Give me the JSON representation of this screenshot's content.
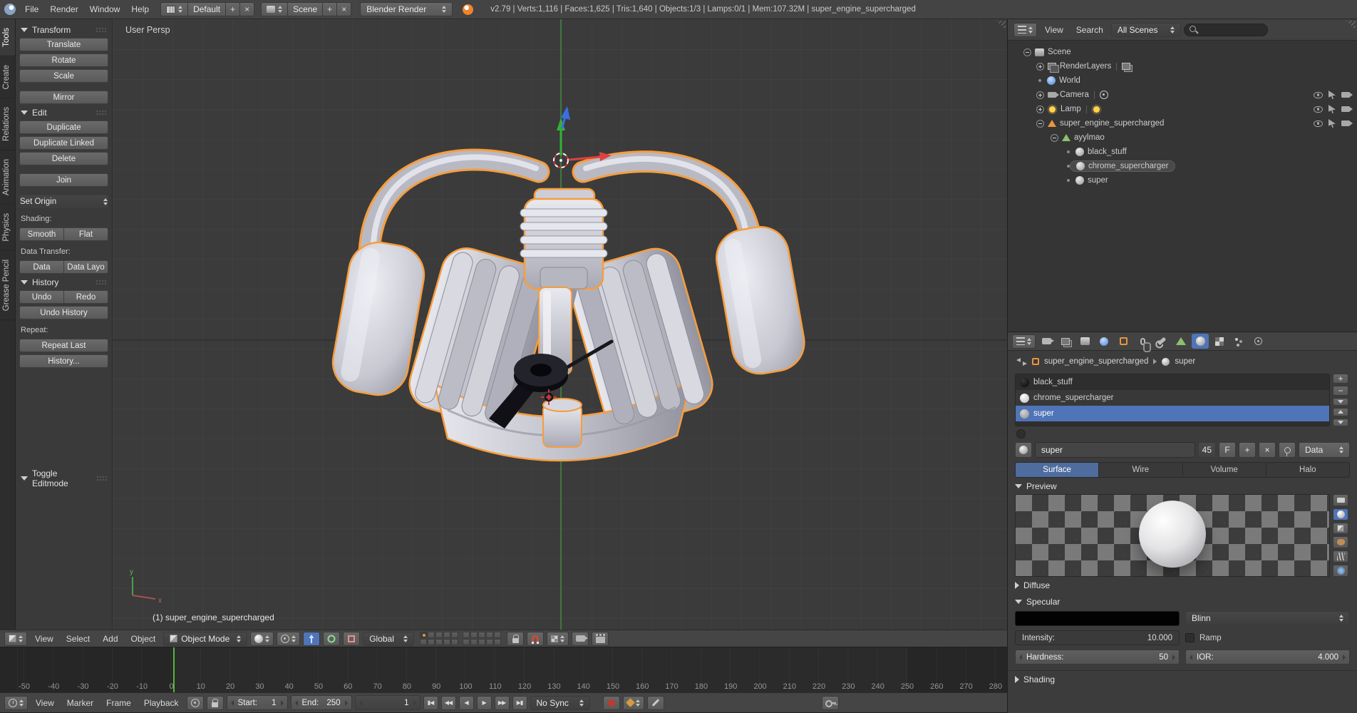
{
  "colors": {
    "accent": "#4f74b8",
    "selection_outline": "#f79d3c",
    "frame_line": "#52b83c",
    "record_red": "#c0392b"
  },
  "icons": {
    "plus": "+",
    "close": "×",
    "minus": "−"
  },
  "topbar": {
    "menus": [
      "File",
      "Render",
      "Window",
      "Help"
    ],
    "layout": {
      "value": "Default",
      "add": "+",
      "close": "×"
    },
    "scene": {
      "value": "Scene",
      "add": "+",
      "close": "×"
    },
    "engine": {
      "value": "Blender Render"
    },
    "stats": "v2.79 | Verts:1,116 | Faces:1,625 | Tris:1,640 | Objects:1/3 | Lamps:0/1 | Mem:107.32M | super_engine_supercharged"
  },
  "toolshelf": {
    "tabs": [
      "Tools",
      "Create",
      "Relations",
      "Animation",
      "Physics",
      "Grease Pencil"
    ],
    "panels": {
      "transform": {
        "title": "Transform",
        "translate": "Translate",
        "rotate": "Rotate",
        "scale": "Scale",
        "mirror": "Mirror"
      },
      "edit": {
        "title": "Edit",
        "duplicate": "Duplicate",
        "duplicate_linked": "Duplicate Linked",
        "delete": "Delete",
        "join": "Join",
        "set_origin": "Set Origin",
        "shading_label": "Shading:",
        "smooth": "Smooth",
        "flat": "Flat",
        "data_transfer_label": "Data Transfer:",
        "data": "Data",
        "data_layout": "Data Layo"
      },
      "history": {
        "title": "History",
        "undo": "Undo",
        "redo": "Redo",
        "undo_history": "Undo History",
        "repeat_label": "Repeat:",
        "repeat_last": "Repeat Last",
        "history_menu": "History..."
      },
      "toggle_editmode": "Toggle Editmode"
    }
  },
  "viewport": {
    "view_label": "User Persp",
    "active_object_label": "(1) super_engine_supercharged",
    "gizmo": {
      "x": "x",
      "y": "y"
    },
    "header": {
      "menus": [
        "View",
        "Select",
        "Add",
        "Object"
      ],
      "mode": "Object Mode",
      "orientation": "Global"
    }
  },
  "outliner": {
    "header": {
      "menus": [
        "View",
        "Search"
      ],
      "display_filter": "All Scenes"
    },
    "tree": [
      {
        "label": "Scene"
      },
      {
        "label": "RenderLayers"
      },
      {
        "label": "World"
      },
      {
        "label": "Camera"
      },
      {
        "label": "Lamp"
      },
      {
        "label": "super_engine_supercharged"
      },
      {
        "label": "ayylmao"
      },
      {
        "label": "black_stuff"
      },
      {
        "label": "chrome_supercharger"
      },
      {
        "label": "super"
      }
    ]
  },
  "properties": {
    "breadcrumb": {
      "object": "super_engine_supercharged",
      "material": "super"
    },
    "slots": [
      {
        "name": "black_stuff"
      },
      {
        "name": "chrome_supercharger"
      },
      {
        "name": "super"
      }
    ],
    "name_field": "super",
    "users": "45",
    "fake_user": "F",
    "link": "Data",
    "type_tabs": [
      "Surface",
      "Wire",
      "Volume",
      "Halo"
    ],
    "panels": {
      "preview": "Preview",
      "diffuse": "Diffuse",
      "specular": "Specular",
      "shading": "Shading"
    },
    "specular": {
      "shader": "Blinn",
      "intensity_label": "Intensity:",
      "intensity": "10.000",
      "ramp": "Ramp",
      "hardness_label": "Hardness:",
      "hardness": "50",
      "ior_label": "IOR:",
      "ior": "4.000"
    }
  },
  "timeline": {
    "ticks": [
      "-50",
      "-40",
      "-30",
      "-20",
      "-10",
      "0",
      "10",
      "20",
      "30",
      "40",
      "50",
      "60",
      "70",
      "80",
      "90",
      "100",
      "110",
      "120",
      "130",
      "140",
      "150",
      "160",
      "170",
      "180",
      "190",
      "200",
      "210",
      "220",
      "230",
      "240",
      "250",
      "260",
      "270",
      "280"
    ],
    "header": {
      "menus": [
        "View",
        "Marker",
        "Frame",
        "Playback"
      ],
      "start_label": "Start:",
      "start": "1",
      "end_label": "End:",
      "end": "250",
      "current": "1",
      "sync": "No Sync",
      "transport": [
        "▮◀",
        "◀◀",
        "◀",
        "▶",
        "▶▶",
        "▶▮"
      ]
    }
  }
}
